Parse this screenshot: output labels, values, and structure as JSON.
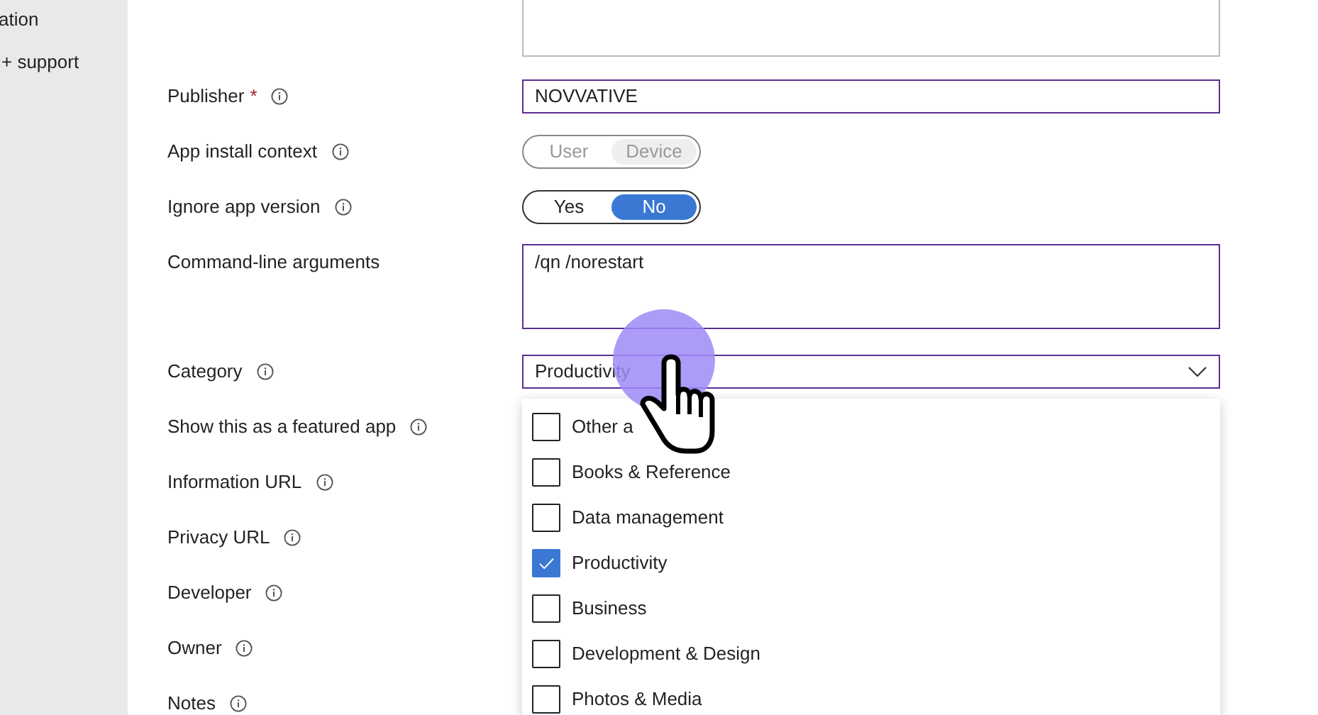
{
  "sidebar": {
    "items": [
      {
        "label": "ation"
      },
      {
        "label": "+ support"
      }
    ]
  },
  "form": {
    "rows": [
      {
        "kind": "text",
        "label": "Publisher",
        "required_mark": "*",
        "info": true,
        "value": "NOVVATIVE"
      },
      {
        "kind": "toggle",
        "label": "App install context",
        "info": true,
        "disabled": true,
        "options": [
          {
            "label": "User",
            "selected": false
          },
          {
            "label": "Device",
            "selected": true
          }
        ]
      },
      {
        "kind": "toggle",
        "label": "Ignore app version",
        "info": true,
        "disabled": false,
        "options": [
          {
            "label": "Yes",
            "selected": false
          },
          {
            "label": "No",
            "selected": true
          }
        ]
      },
      {
        "kind": "textarea",
        "label": "Command-line arguments",
        "info": false,
        "value": "/qn /norestart"
      },
      {
        "kind": "select",
        "label": "Category",
        "info": true,
        "value": "Productivity",
        "expanded": true
      },
      {
        "kind": "plain",
        "label": "Show this as a featured app",
        "info": true
      },
      {
        "kind": "plain",
        "label": "Information URL",
        "info": true
      },
      {
        "kind": "plain",
        "label": "Privacy URL",
        "info": true
      },
      {
        "kind": "plain",
        "label": "Developer",
        "info": true
      },
      {
        "kind": "plain",
        "label": "Owner",
        "info": true
      },
      {
        "kind": "plain",
        "label": "Notes",
        "info": true
      }
    ]
  },
  "category_options": [
    {
      "label": "Other a",
      "checked": false
    },
    {
      "label": "Books & Reference",
      "checked": false
    },
    {
      "label": "Data management",
      "checked": false
    },
    {
      "label": "Productivity",
      "checked": true
    },
    {
      "label": "Business",
      "checked": false
    },
    {
      "label": "Development & Design",
      "checked": false
    },
    {
      "label": "Photos & Media",
      "checked": false
    }
  ]
}
